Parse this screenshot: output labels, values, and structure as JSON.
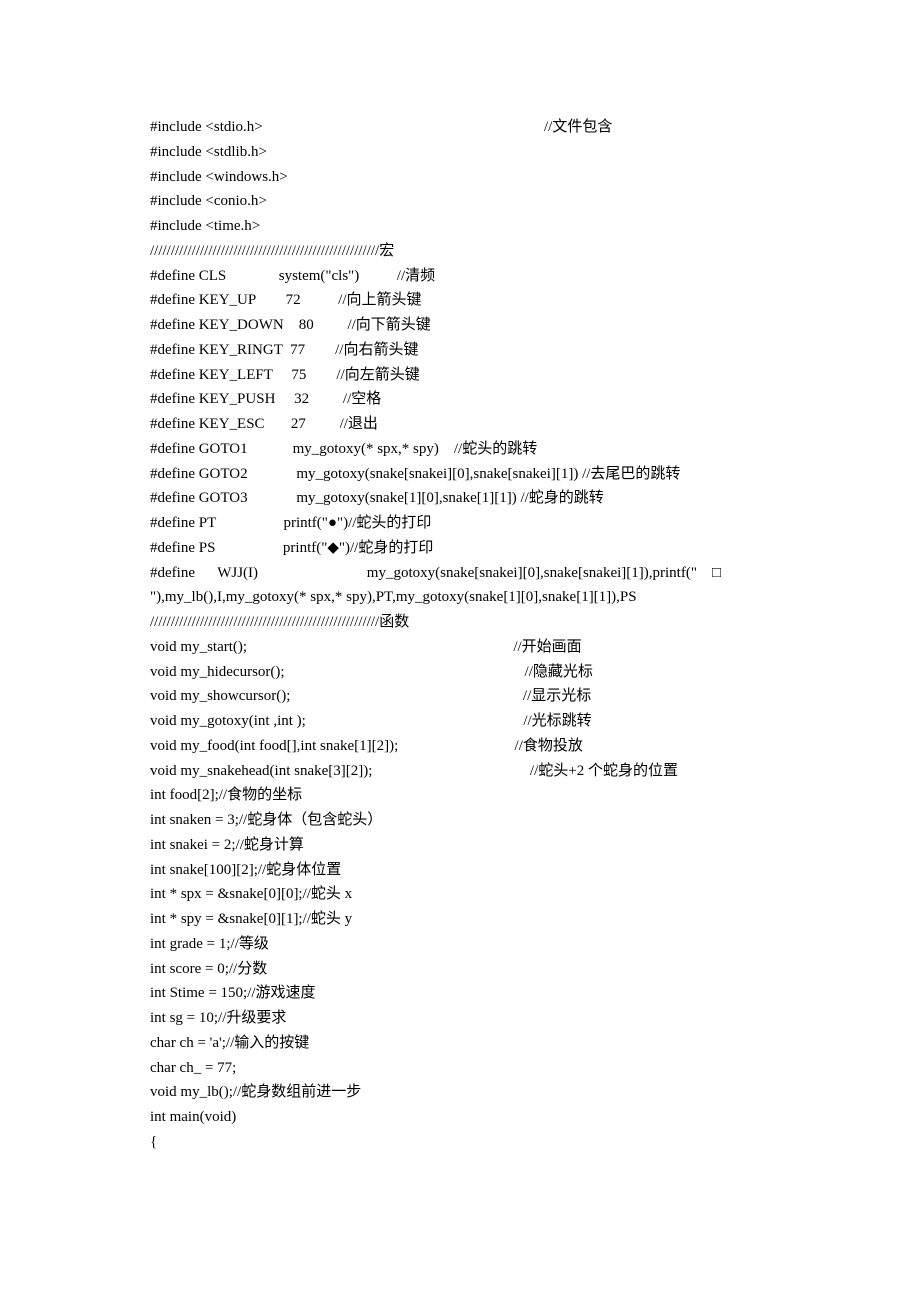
{
  "lines": [
    "#include <stdio.h>                                                                           //文件包含",
    "#include <stdlib.h>",
    "#include <windows.h>",
    "#include <conio.h>",
    "#include <time.h>",
    "///////////////////////////////////////////////////////宏",
    "#define CLS              system(\"cls\")          //清频",
    "#define KEY_UP        72          //向上箭头键",
    "#define KEY_DOWN    80         //向下箭头键",
    "#define KEY_RINGT  77        //向右箭头键",
    "#define KEY_LEFT     75        //向左箭头键",
    "#define KEY_PUSH     32         //空格",
    "#define KEY_ESC       27         //退出",
    "#define GOTO1            my_gotoxy(* spx,* spy)    //蛇头的跳转",
    "#define GOTO2             my_gotoxy(snake[snakei][0],snake[snakei][1]) //去尾巴的跳转",
    "#define GOTO3             my_gotoxy(snake[1][0],snake[1][1]) //蛇身的跳转",
    "#define PT                  printf(\"●\")//蛇头的打印",
    "#define PS                  printf(\"◆\")//蛇身的打印",
    "#define      WJJ(I)                             my_gotoxy(snake[snakei][0],snake[snakei][1]),printf(\"    □",
    "\"),my_lb(),I,my_gotoxy(* spx,* spy),PT,my_gotoxy(snake[1][0],snake[1][1]),PS",
    "///////////////////////////////////////////////////////函数",
    "void my_start();                                                                       //开始画面",
    "void my_hidecursor();                                                                //隐藏光标",
    "void my_showcursor();                                                              //显示光标",
    "void my_gotoxy(int ,int );                                                          //光标跳转",
    "void my_food(int food[],int snake[1][2]);                               //食物投放",
    "void my_snakehead(int snake[3][2]);                                          //蛇头+2 个蛇身的位置",
    "",
    "",
    "int food[2];//食物的坐标",
    "int snaken = 3;//蛇身体（包含蛇头）",
    "int snakei = 2;//蛇身计算",
    "int snake[100][2];//蛇身体位置",
    "int * spx = &snake[0][0];//蛇头 x",
    "int * spy = &snake[0][1];//蛇头 y",
    "int grade = 1;//等级",
    "int score = 0;//分数",
    "int Stime = 150;//游戏速度",
    "int sg = 10;//升级要求",
    "char ch = 'a';//输入的按键",
    "char ch_ = 77;",
    "void my_lb();//蛇身数组前进一步",
    "int main(void)",
    "{"
  ]
}
